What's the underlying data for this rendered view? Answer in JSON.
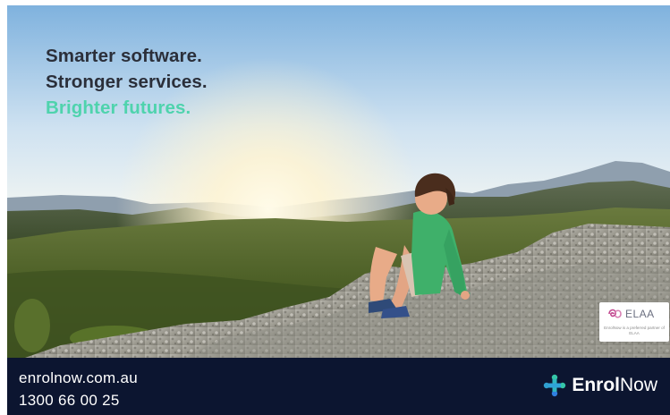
{
  "headline": {
    "line1": "Smarter software.",
    "line2": "Stronger services.",
    "line3": "Brighter futures."
  },
  "badge": {
    "logo_text": "ELAA",
    "caption": "EnrolNow is a preferred partner of ELAA",
    "icon": "elaa-logo-icon"
  },
  "footer": {
    "website": "enrolnow.com.au",
    "phone": "1300 66 00 25"
  },
  "brand": {
    "name_bold": "Enrol",
    "name_light": "Now",
    "icon": "enrolnow-cross-logo-icon"
  },
  "colors": {
    "headline": "#2b2f3a",
    "accent": "#4fd3ad",
    "footer_bg": "#0c1530",
    "logo_teal": "#35c6a8",
    "logo_blue": "#2f7fe0"
  }
}
